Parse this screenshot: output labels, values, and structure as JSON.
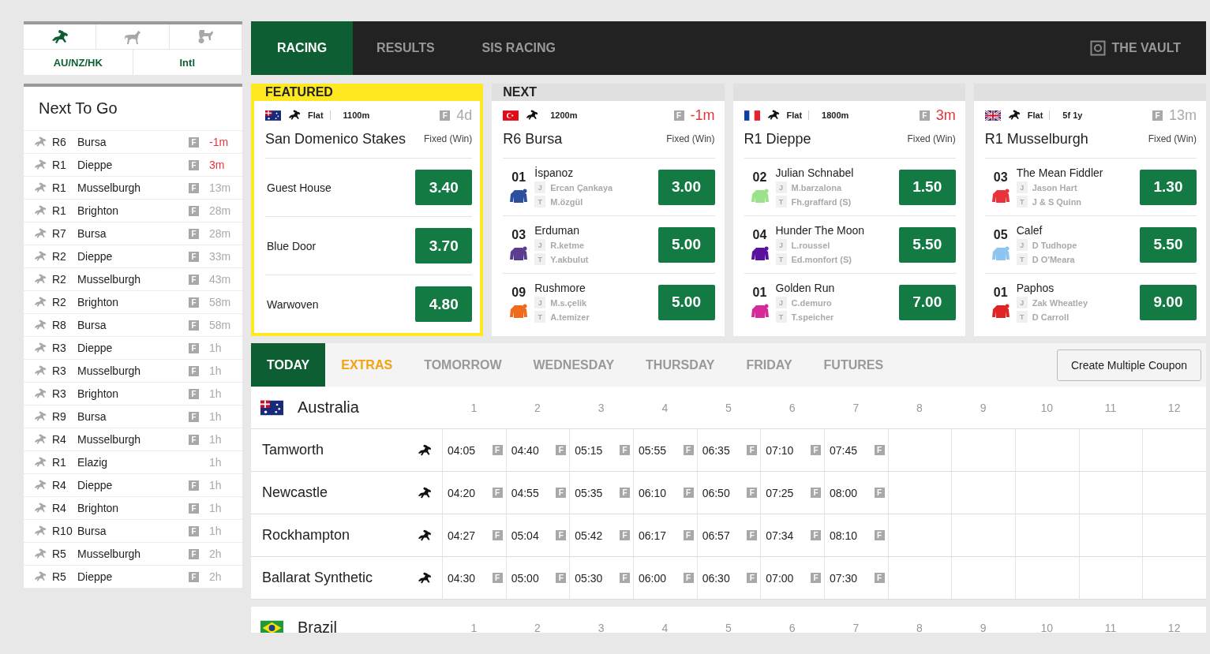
{
  "sport_tabs": [
    {
      "kind": "horse",
      "selected": true
    },
    {
      "kind": "greyhound",
      "selected": false
    },
    {
      "kind": "harness",
      "selected": false
    }
  ],
  "region_tabs": [
    {
      "label": "AU/NZ/HK"
    },
    {
      "label": "Intl"
    }
  ],
  "next_to_go": {
    "title": "Next To Go",
    "items": [
      {
        "race": "R6",
        "venue": "Bursa",
        "badge": "F",
        "time": "-1m",
        "urgent": true
      },
      {
        "race": "R1",
        "venue": "Dieppe",
        "badge": "F",
        "time": "3m",
        "urgent": true
      },
      {
        "race": "R1",
        "venue": "Musselburgh",
        "badge": "F",
        "time": "13m",
        "urgent": false
      },
      {
        "race": "R1",
        "venue": "Brighton",
        "badge": "F",
        "time": "28m",
        "urgent": false
      },
      {
        "race": "R7",
        "venue": "Bursa",
        "badge": "F",
        "time": "28m",
        "urgent": false
      },
      {
        "race": "R2",
        "venue": "Dieppe",
        "badge": "F",
        "time": "33m",
        "urgent": false
      },
      {
        "race": "R2",
        "venue": "Musselburgh",
        "badge": "F",
        "time": "43m",
        "urgent": false
      },
      {
        "race": "R2",
        "venue": "Brighton",
        "badge": "F",
        "time": "58m",
        "urgent": false
      },
      {
        "race": "R8",
        "venue": "Bursa",
        "badge": "F",
        "time": "58m",
        "urgent": false
      },
      {
        "race": "R3",
        "venue": "Dieppe",
        "badge": "F",
        "time": "1h",
        "urgent": false
      },
      {
        "race": "R3",
        "venue": "Musselburgh",
        "badge": "F",
        "time": "1h",
        "urgent": false
      },
      {
        "race": "R3",
        "venue": "Brighton",
        "badge": "F",
        "time": "1h",
        "urgent": false
      },
      {
        "race": "R9",
        "venue": "Bursa",
        "badge": "F",
        "time": "1h",
        "urgent": false
      },
      {
        "race": "R4",
        "venue": "Musselburgh",
        "badge": "F",
        "time": "1h",
        "urgent": false
      },
      {
        "race": "R1",
        "venue": "Elazig",
        "time": "1h",
        "urgent": false
      },
      {
        "race": "R4",
        "venue": "Dieppe",
        "badge": "F",
        "time": "1h",
        "urgent": false
      },
      {
        "race": "R4",
        "venue": "Brighton",
        "badge": "F",
        "time": "1h",
        "urgent": false
      },
      {
        "race": "R10",
        "venue": "Bursa",
        "badge": "F",
        "time": "1h",
        "urgent": false
      },
      {
        "race": "R5",
        "venue": "Musselburgh",
        "badge": "F",
        "time": "2h",
        "urgent": false
      },
      {
        "race": "R5",
        "venue": "Dieppe",
        "badge": "F",
        "time": "2h",
        "urgent": false
      }
    ]
  },
  "nav": {
    "tabs": [
      {
        "label": "RACING",
        "selected": true
      },
      {
        "label": "RESULTS",
        "selected": false
      },
      {
        "label": "SIS RACING",
        "selected": false
      }
    ],
    "vault": "THE VAULT"
  },
  "featured": {
    "heading": "FEATURED",
    "race_type": "Flat",
    "distance": "1100m",
    "badge": "F",
    "time": "4d",
    "urgent": false,
    "name": "San Domenico Stakes",
    "bet_type": "Fixed (Win)",
    "runners": [
      {
        "name": "Guest House",
        "odds": "3.40"
      },
      {
        "name": "Blue Door",
        "odds": "3.70"
      },
      {
        "name": "Warwoven",
        "odds": "4.80"
      }
    ]
  },
  "next_races": [
    {
      "heading": "NEXT",
      "distance": "1200m",
      "badge": "F",
      "time": "-1m",
      "urgent": true,
      "name": "R6 Bursa",
      "bet_type": "Fixed (Win)",
      "runners": [
        {
          "number": "01",
          "name": "İspanoz",
          "jockey_tag": "J",
          "jockey": "Ercan Çankaya",
          "trainer_tag": "T",
          "trainer": "M.özgül",
          "odds": "3.00",
          "color": "#2a4f9e"
        },
        {
          "number": "03",
          "name": "Erduman",
          "jockey_tag": "J",
          "jockey": "R.ketme",
          "trainer_tag": "T",
          "trainer": "Y.akbulut",
          "odds": "5.00",
          "color": "#5b3d8f"
        },
        {
          "number": "09",
          "name": "Rushmore",
          "jockey_tag": "J",
          "jockey": "M.s.çelik",
          "trainer_tag": "T",
          "trainer": "A.temizer",
          "odds": "5.00",
          "color": "#f06a1e"
        }
      ]
    },
    {
      "race_type": "Flat",
      "distance": "1800m",
      "badge": "F",
      "time": "3m",
      "urgent": true,
      "name": "R1 Dieppe",
      "bet_type": "Fixed (Win)",
      "runners": [
        {
          "number": "02",
          "name": "Julian Schnabel",
          "jockey_tag": "J",
          "jockey": "M.barzalona",
          "trainer_tag": "T",
          "trainer": "Fh.graffard (S)",
          "odds": "1.50",
          "color": "#9be38a"
        },
        {
          "number": "04",
          "name": "Hunder The Moon",
          "jockey_tag": "J",
          "jockey": "L.roussel",
          "trainer_tag": "T",
          "trainer": "Ed.monfort (S)",
          "odds": "5.50",
          "color": "#5a129e"
        },
        {
          "number": "01",
          "name": "Golden Run",
          "jockey_tag": "J",
          "jockey": "C.demuro",
          "trainer_tag": "T",
          "trainer": "T.speicher",
          "odds": "7.00",
          "color": "#d62a9a"
        }
      ]
    },
    {
      "race_type": "Flat",
      "distance": "5f 1y",
      "badge": "F",
      "time": "13m",
      "urgent": false,
      "name": "R1 Musselburgh",
      "bet_type": "Fixed (Win)",
      "runners": [
        {
          "number": "03",
          "name": "The Mean Fiddler",
          "jockey_tag": "J",
          "jockey": "Jason Hart",
          "trainer_tag": "T",
          "trainer": "J & S Quinn",
          "odds": "1.30",
          "color": "#e8333a"
        },
        {
          "number": "05",
          "name": "Calef",
          "jockey_tag": "J",
          "jockey": "D Tudhope",
          "trainer_tag": "T",
          "trainer": "D O'Meara",
          "odds": "5.50",
          "color": "#8cc6f0"
        },
        {
          "number": "01",
          "name": "Paphos",
          "jockey_tag": "J",
          "jockey": "Zak Wheatley",
          "trainer_tag": "T",
          "trainer": "D Carroll",
          "odds": "9.00",
          "color": "#e02424"
        }
      ]
    }
  ],
  "day_tabs": [
    {
      "label": "TODAY",
      "selected": true,
      "highlighted": false
    },
    {
      "label": "EXTRAS",
      "selected": false,
      "highlighted": true
    },
    {
      "label": "TOMORROW",
      "selected": false,
      "highlighted": false
    },
    {
      "label": "WEDNESDAY",
      "selected": false,
      "highlighted": false
    },
    {
      "label": "THURSDAY",
      "selected": false,
      "highlighted": false
    },
    {
      "label": "FRIDAY",
      "selected": false,
      "highlighted": false
    },
    {
      "label": "FUTURES",
      "selected": false,
      "highlighted": false
    }
  ],
  "coupon_button": "Create Multiple Coupon",
  "meetings": [
    {
      "country": "Australia",
      "columns": [
        "1",
        "2",
        "3",
        "4",
        "5",
        "6",
        "7",
        "8",
        "9",
        "10",
        "11",
        "12"
      ],
      "venues": [
        {
          "name": "Tamworth",
          "races": [
            {
              "time": "04:05",
              "badge": "F"
            },
            {
              "time": "04:40",
              "badge": "F"
            },
            {
              "time": "05:15",
              "badge": "F"
            },
            {
              "time": "05:55",
              "badge": "F"
            },
            {
              "time": "06:35",
              "badge": "F"
            },
            {
              "time": "07:10",
              "badge": "F"
            },
            {
              "time": "07:45",
              "badge": "F"
            }
          ]
        },
        {
          "name": "Newcastle",
          "races": [
            {
              "time": "04:20",
              "badge": "F"
            },
            {
              "time": "04:55",
              "badge": "F"
            },
            {
              "time": "05:35",
              "badge": "F"
            },
            {
              "time": "06:10",
              "badge": "F"
            },
            {
              "time": "06:50",
              "badge": "F"
            },
            {
              "time": "07:25",
              "badge": "F"
            },
            {
              "time": "08:00",
              "badge": "F"
            }
          ]
        },
        {
          "name": "Rockhampton",
          "races": [
            {
              "time": "04:27",
              "badge": "F"
            },
            {
              "time": "05:04",
              "badge": "F"
            },
            {
              "time": "05:42",
              "badge": "F"
            },
            {
              "time": "06:17",
              "badge": "F"
            },
            {
              "time": "06:57",
              "badge": "F"
            },
            {
              "time": "07:34",
              "badge": "F"
            },
            {
              "time": "08:10",
              "badge": "F"
            }
          ]
        },
        {
          "name": "Ballarat Synthetic",
          "races": [
            {
              "time": "04:30",
              "badge": "F"
            },
            {
              "time": "05:00",
              "badge": "F"
            },
            {
              "time": "05:30",
              "badge": "F"
            },
            {
              "time": "06:00",
              "badge": "F"
            },
            {
              "time": "06:30",
              "badge": "F"
            },
            {
              "time": "07:00",
              "badge": "F"
            },
            {
              "time": "07:30",
              "badge": "F"
            }
          ]
        }
      ]
    },
    {
      "country": "Brazil",
      "columns": [
        "1",
        "2",
        "3",
        "4",
        "5",
        "6",
        "7",
        "8",
        "9",
        "10",
        "11",
        "12"
      ]
    }
  ]
}
